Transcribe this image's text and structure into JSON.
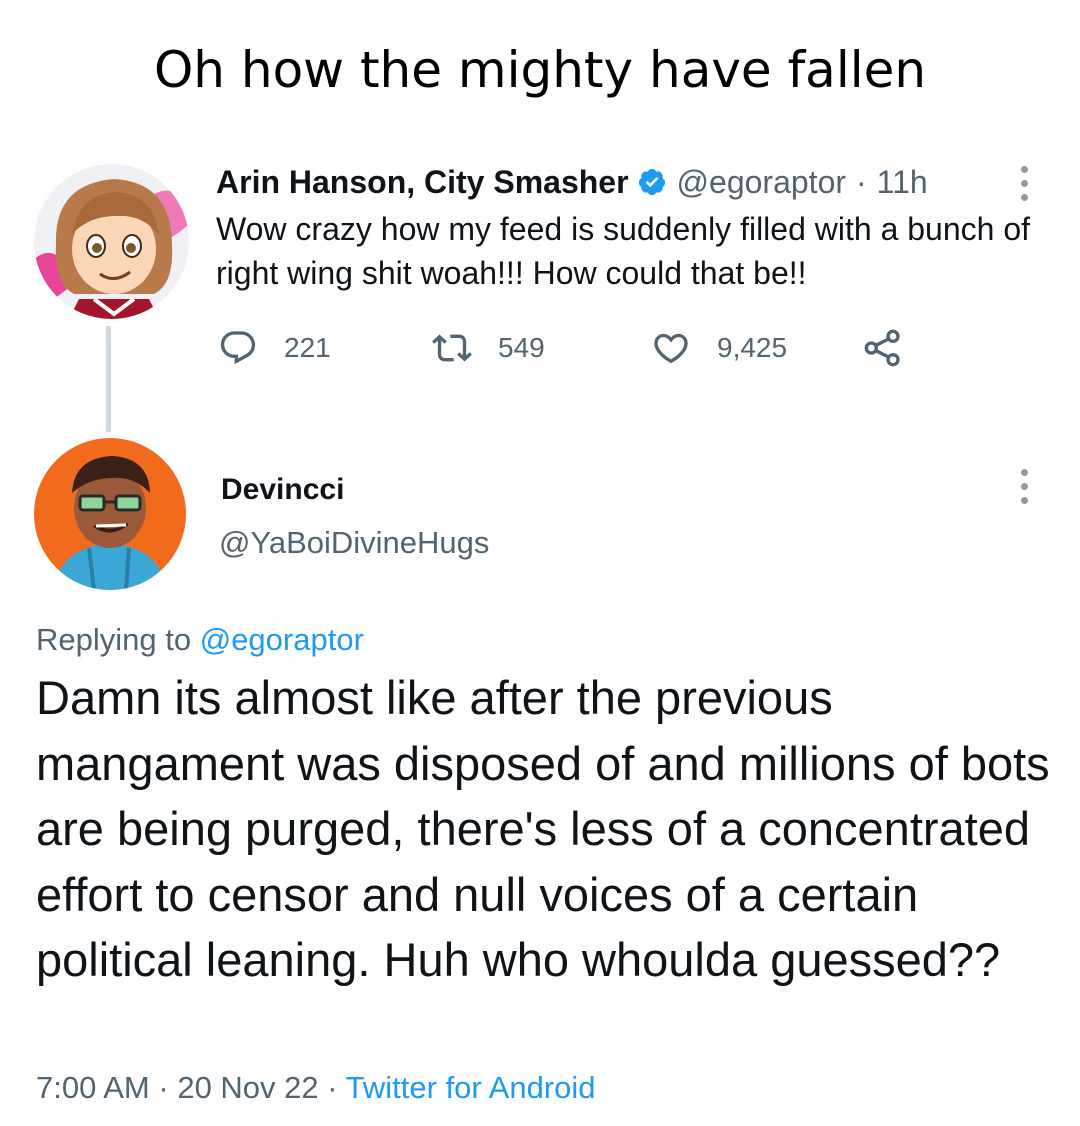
{
  "caption": "Oh how the mighty have fallen",
  "colors": {
    "text": "#0f1419",
    "secondary": "#536471",
    "link": "#1d9bf0",
    "thread_line": "#cfd9de"
  },
  "original_tweet": {
    "avatar_icon": "cartoon-avatar-arin",
    "display_name": "Arin Hanson, City Smasher",
    "verified_icon": "verified-badge-icon",
    "handle": "@egoraptor",
    "separator": "·",
    "age": "11h",
    "text": "Wow crazy how my feed is suddenly filled with a bunch of right wing shit woah!!! How could that be!!",
    "actions": {
      "replies": "221",
      "retweets": "549",
      "likes": "9,425"
    }
  },
  "reply_tweet": {
    "avatar_icon": "cartoon-avatar-devincci",
    "display_name": "Devincci",
    "handle": "@YaBoiDivineHugs",
    "replying_prefix": "Replying to",
    "replying_to": "@egoraptor",
    "text": "Damn its almost like after the previous mangament was disposed of and millions of bots are being purged, there's less of a concentrated effort to censor and null voices of a certain political leaning. Huh who whoulda guessed??",
    "time": "7:00 AM",
    "separator": "·",
    "date": "20 Nov 22",
    "source": "Twitter for Android"
  }
}
